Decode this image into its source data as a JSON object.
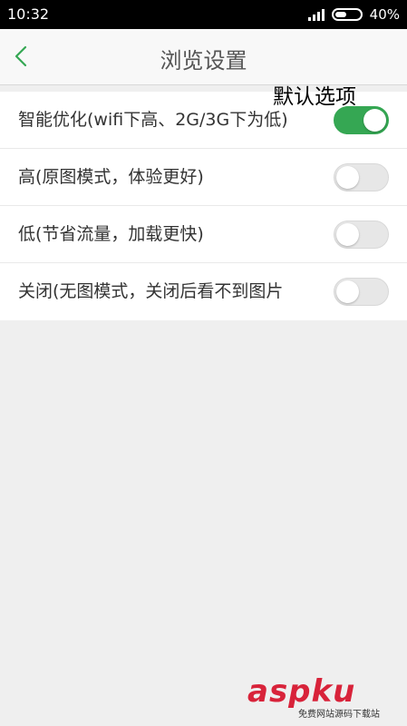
{
  "status_bar": {
    "time": "10:32",
    "battery": "40%"
  },
  "header": {
    "title": "浏览设置",
    "back_icon": "chevron-left-icon",
    "accent": "#35a753"
  },
  "annotation": "默认选项",
  "settings": [
    {
      "label": "智能优化(wifi下高、2G/3G下为低)",
      "enabled": true
    },
    {
      "label": "高(原图模式，体验更好)",
      "enabled": false
    },
    {
      "label": "低(节省流量，加载更快)",
      "enabled": false
    },
    {
      "label": "关闭(无图模式，关闭后看不到图片",
      "enabled": false
    }
  ],
  "watermark": {
    "text": "aspku",
    "subtext": "免费网站源码下载站"
  }
}
